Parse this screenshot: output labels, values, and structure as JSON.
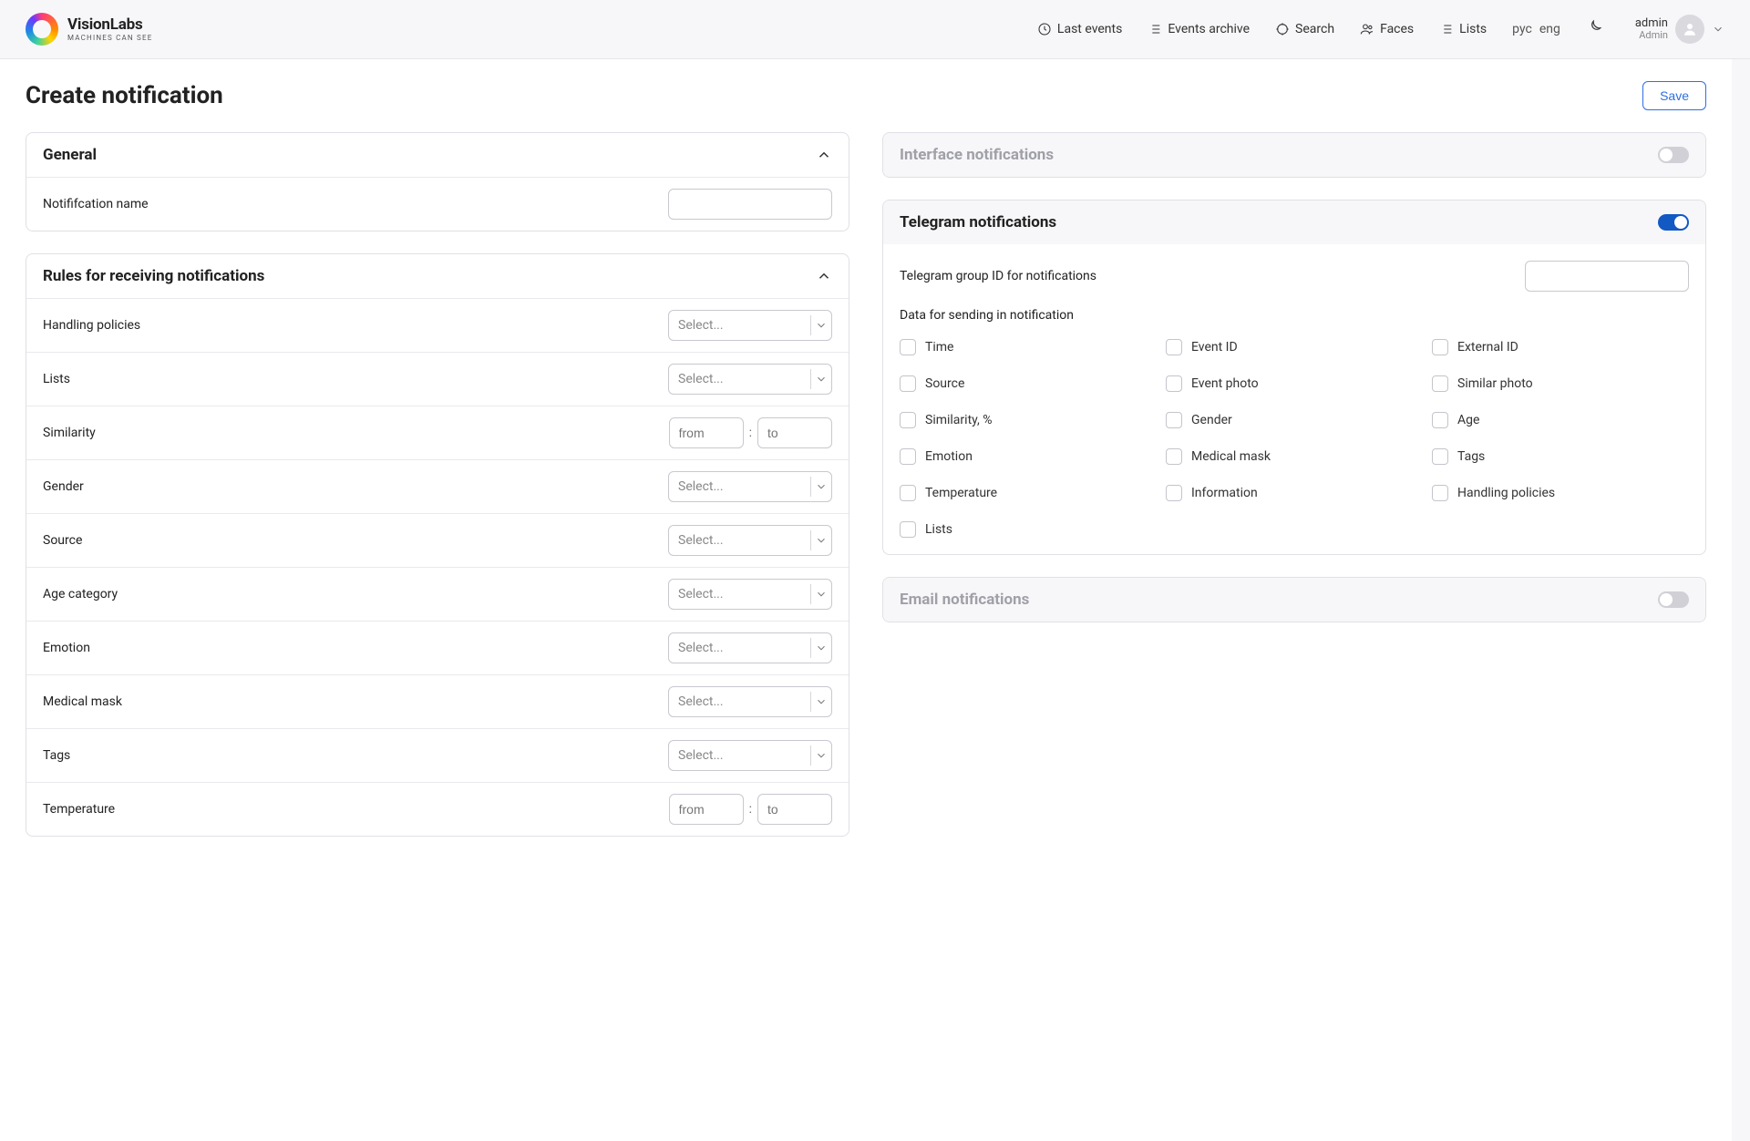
{
  "brand": {
    "name": "VisionLabs",
    "tagline": "MACHINES CAN SEE"
  },
  "nav": {
    "last_events": "Last events",
    "events_archive": "Events archive",
    "search": "Search",
    "faces": "Faces",
    "lists": "Lists"
  },
  "lang": {
    "ru": "рус",
    "en": "eng"
  },
  "user": {
    "name": "admin",
    "role": "Admin"
  },
  "page": {
    "title": "Create notification",
    "save": "Save"
  },
  "general": {
    "title": "General",
    "notification_name_label": "Notififcation name",
    "notification_name_value": ""
  },
  "rules": {
    "title": "Rules for receiving notifications",
    "select_placeholder": "Select...",
    "from_placeholder": "from",
    "to_placeholder": "to",
    "items": {
      "handling_policies": "Handling policies",
      "lists": "Lists",
      "similarity": "Similarity",
      "gender": "Gender",
      "source": "Source",
      "age_category": "Age category",
      "emotion": "Emotion",
      "medical_mask": "Medical mask",
      "tags": "Tags",
      "temperature": "Temperature"
    }
  },
  "interface_notifications": {
    "title": "Interface notifications",
    "enabled": false
  },
  "telegram": {
    "title": "Telegram notifications",
    "enabled": true,
    "group_id_label": "Telegram group ID for notifications",
    "group_id_value": "",
    "data_title": "Data for sending in notification",
    "checks": {
      "time": "Time",
      "event_id": "Event ID",
      "external_id": "External ID",
      "source": "Source",
      "event_photo": "Event photo",
      "similar_photo": "Similar photo",
      "similarity_pct": "Similarity, %",
      "gender": "Gender",
      "age": "Age",
      "emotion": "Emotion",
      "medical_mask": "Medical mask",
      "tags": "Tags",
      "temperature": "Temperature",
      "information": "Information",
      "handling_policies": "Handling policies",
      "lists": "Lists"
    }
  },
  "email_notifications": {
    "title": "Email notifications",
    "enabled": false
  }
}
